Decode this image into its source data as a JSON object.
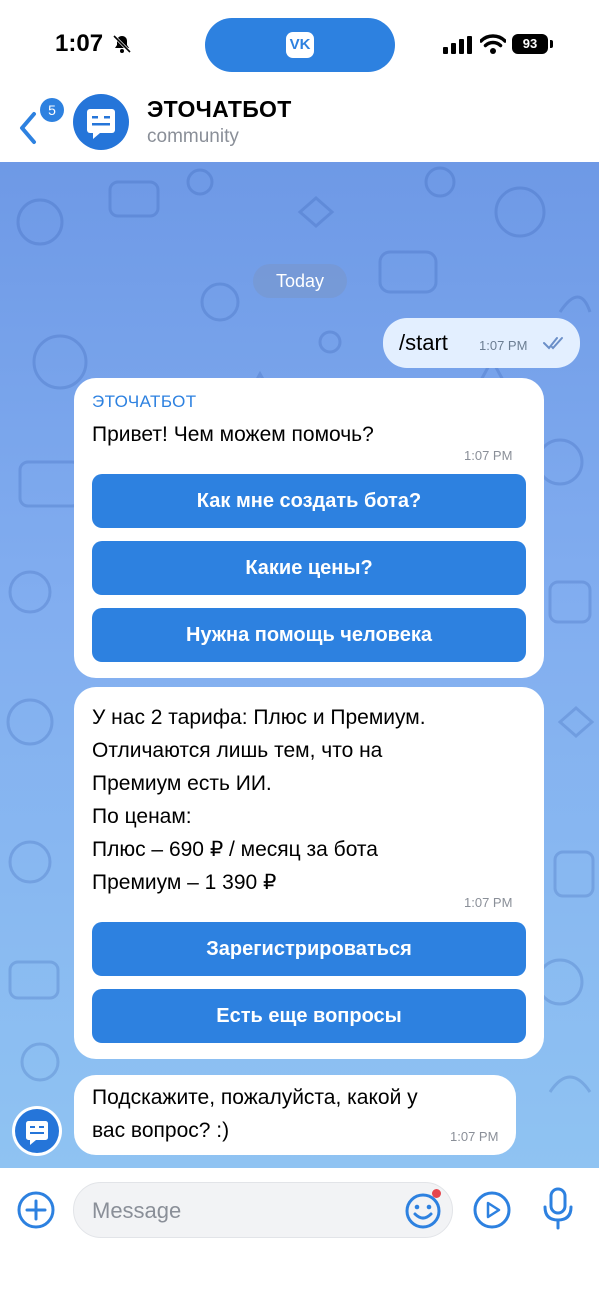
{
  "status_bar": {
    "time": "1:07",
    "battery": "93",
    "app_icon": "vk-logo",
    "app_logo_text": "VK"
  },
  "header": {
    "back_badge": "5",
    "title": "ЭТОЧАТБОТ",
    "subtitle": "community",
    "avatar_icon": "bot-icon"
  },
  "chat": {
    "date_chip": "Today",
    "outgoing": {
      "text": "/start",
      "time": "1:07 PM",
      "status_icon": "double-check-icon"
    },
    "messages": [
      {
        "sender": "ЭТОЧАТБОТ",
        "lines": [
          "Привет! Чем можем помочь?"
        ],
        "time": "1:07 PM",
        "buttons": [
          "Как мне создать бота?",
          "Какие цены?",
          "Нужна помощь человека"
        ]
      },
      {
        "lines": [
          "У нас 2 тарифа: Плюс и Премиум.",
          "Отличаются лишь тем, что на",
          "Премиум есть ИИ.",
          "По ценам:",
          "Плюс – 690 ₽ / месяц за бота",
          "Премиум – 1 390 ₽"
        ],
        "time": "1:07 PM",
        "buttons": [
          "Зарегистрироваться",
          "Есть еще вопросы"
        ]
      },
      {
        "lines": [
          "Подскажите, пожалуйста, какой у",
          "вас вопрос? :)"
        ],
        "time": "1:07 PM"
      }
    ]
  },
  "composer": {
    "placeholder": "Message",
    "icons": [
      "plus-circle-icon",
      "emoji-icon",
      "play-circle-icon",
      "microphone-icon"
    ]
  },
  "colors": {
    "accent": "#2d81e0",
    "bubble_out": "#e3efff",
    "bubble_in": "#ffffff",
    "wallpaper": "#7fa9ee"
  }
}
